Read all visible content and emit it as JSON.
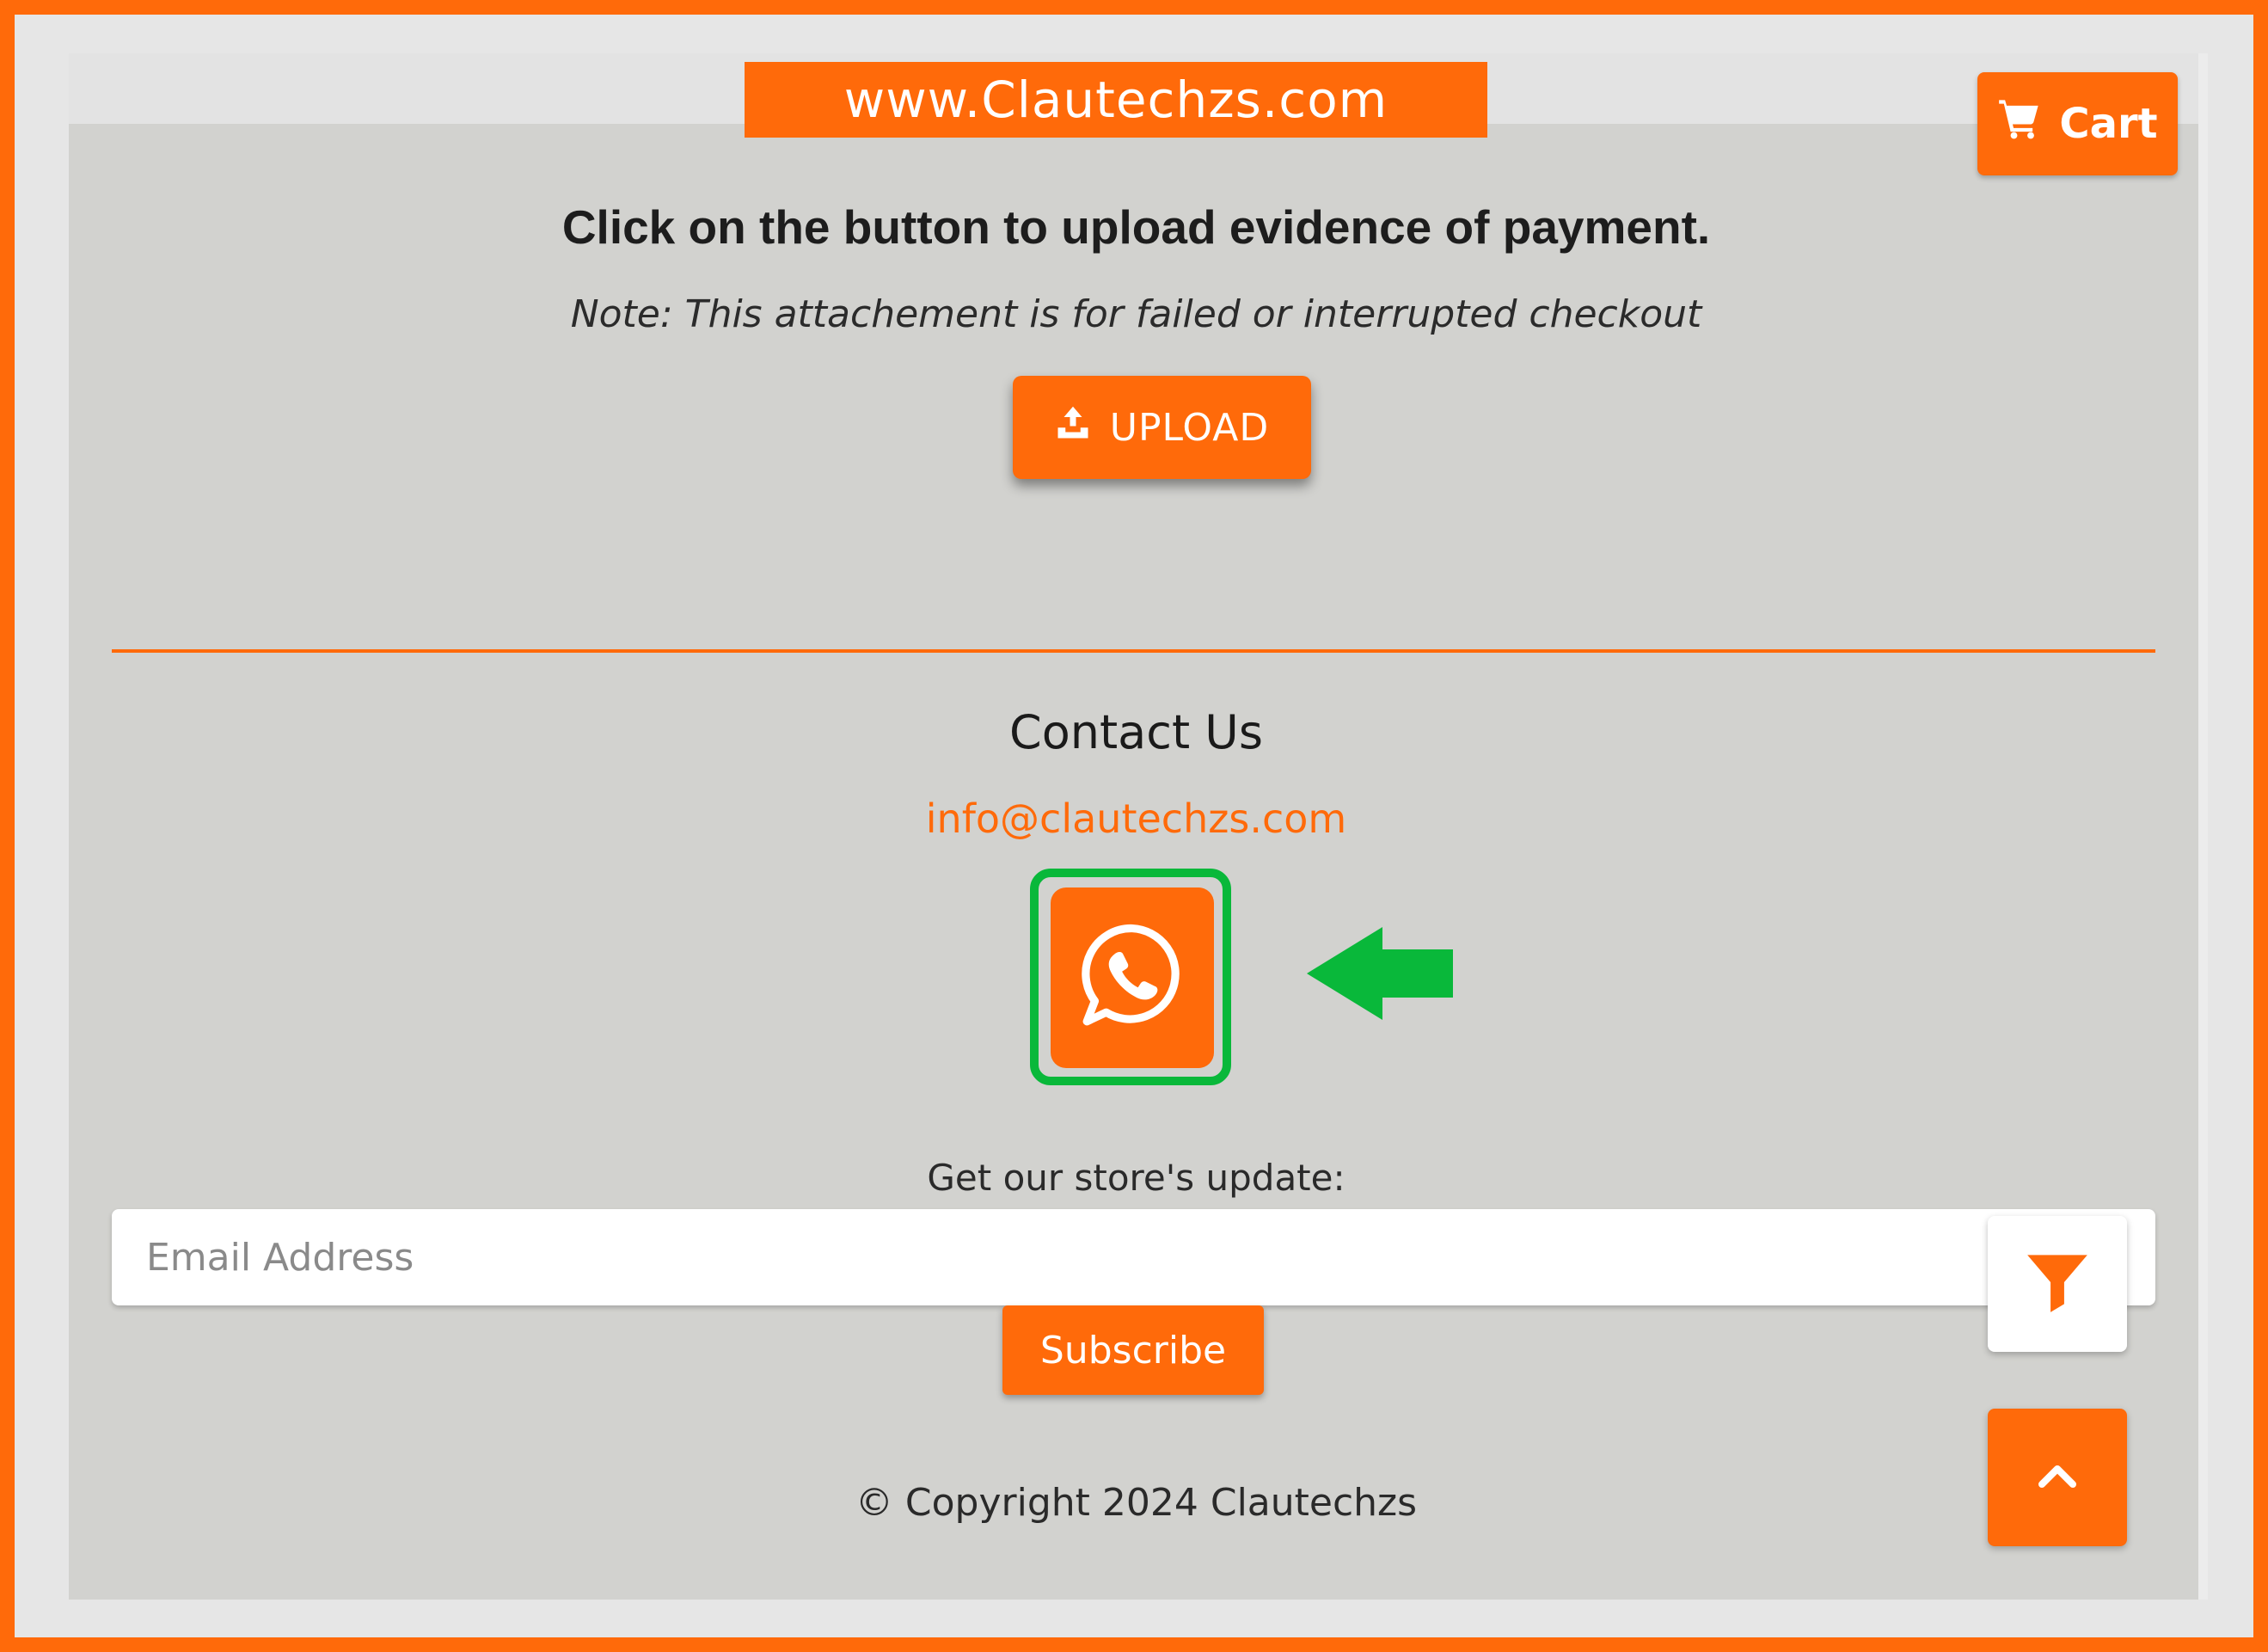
{
  "watermark": {
    "text": "www.Clautechzs.com"
  },
  "header": {
    "cart_label": "Cart",
    "cart_icon": "cart-icon"
  },
  "payment": {
    "heading": "Click on the button to upload evidence of payment.",
    "note": "Note: This attachement is for failed or interrupted checkout",
    "upload_label": "UPLOAD",
    "upload_icon": "upload-icon"
  },
  "contact": {
    "title": "Contact Us",
    "email": "info@clautechzs.com",
    "whatsapp_icon": "whatsapp-icon",
    "annotation_arrow": "green-arrow-left-icon"
  },
  "newsletter": {
    "label": "Get our store's update:",
    "email_placeholder": "Email Address",
    "email_value": "",
    "subscribe_label": "Subscribe"
  },
  "floating": {
    "filter_icon": "filter-icon",
    "scroll_top_icon": "chevron-up-icon"
  },
  "footer": {
    "copyright": "© Copyright 2024 Clautechzs"
  },
  "colors": {
    "accent": "#ff6a0a",
    "page_bg": "#d2d2cf",
    "highlight_green": "#09b83a",
    "text_dark": "#1d1d1d"
  }
}
